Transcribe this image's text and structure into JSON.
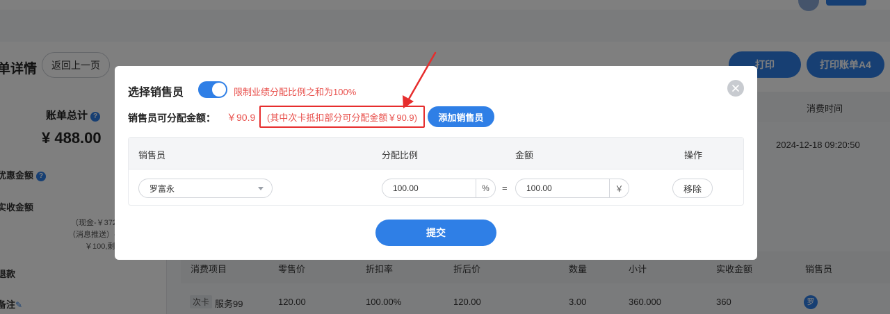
{
  "background": {
    "page_title": "单详情",
    "back_button": "返回上一页",
    "print_button": "打印",
    "print_a4_button": "打印账单A4",
    "bill_total_label": "账单总计",
    "bill_total_value": "¥ 488.00",
    "discount_label": "优惠金额",
    "received_label": "实收金额",
    "received_note_1": "（现金-￥372",
    "received_note_2": "（消息推送）-",
    "received_note_3": "￥100,剩",
    "refund_label": "退款",
    "remark_label": "备注",
    "col_consume_time": "消费时间",
    "consume_time_value": "2024-12-18 09:20:50",
    "table": {
      "headers": [
        "消费项目",
        "零售价",
        "折扣率",
        "折后价",
        "数量",
        "小计",
        "实收金额",
        "销售员"
      ],
      "row": {
        "tag": "次卡",
        "item": "服务99",
        "retail_price": "120.00",
        "discount_rate": "100.00%",
        "discounted_price": "120.00",
        "quantity": "3.00",
        "subtotal": "360.000",
        "received": "360",
        "seller_initial": "罗"
      }
    }
  },
  "dialog": {
    "title": "选择销售员",
    "toggle_on": true,
    "limit_text": "限制业绩分配比例之和为100%",
    "amount_label": "销售员可分配金额：",
    "amount_value": "￥90.9",
    "amount_note": "(其中次卡抵扣部分可分配金额￥90.9)",
    "add_button": "添加销售员",
    "table_headers": {
      "seller": "销售员",
      "ratio": "分配比例",
      "amount": "金额",
      "action": "操作"
    },
    "rows": [
      {
        "seller": "罗富永",
        "ratio": "100.00",
        "ratio_unit": "%",
        "equals": "=",
        "amount": "100.00",
        "amount_unit": "￥",
        "remove": "移除"
      }
    ],
    "submit_button": "提交"
  },
  "colors": {
    "primary": "#2f7fe6",
    "warning_text": "#e8504c",
    "highlight_box": "#e62d2d"
  }
}
